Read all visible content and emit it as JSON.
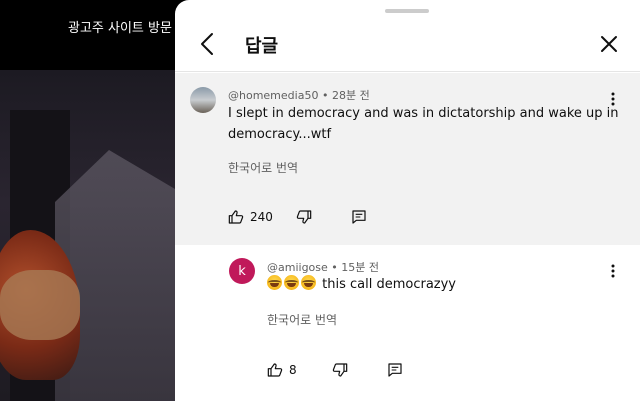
{
  "video": {
    "ad_link": "광고주 사이트 방문"
  },
  "panel": {
    "title": "답글"
  },
  "parent_comment": {
    "author": "@homemedia50",
    "time": "28분 전",
    "text_line1": "I slept in democracy and was in dictatorship and wake up in",
    "text_line2": "democracy...wtf",
    "translate": "한국어로 번역",
    "likes": "240"
  },
  "reply": {
    "avatar_letter": "k",
    "author": "@amiigose",
    "time": "15분 전",
    "emoji_name": "rofl-emoji",
    "text": "this call democrazyy",
    "translate": "한국어로 번역",
    "likes": "8"
  },
  "colors": {
    "reply_avatar": "#c0195a",
    "parent_bg": "#f2f2f2"
  }
}
